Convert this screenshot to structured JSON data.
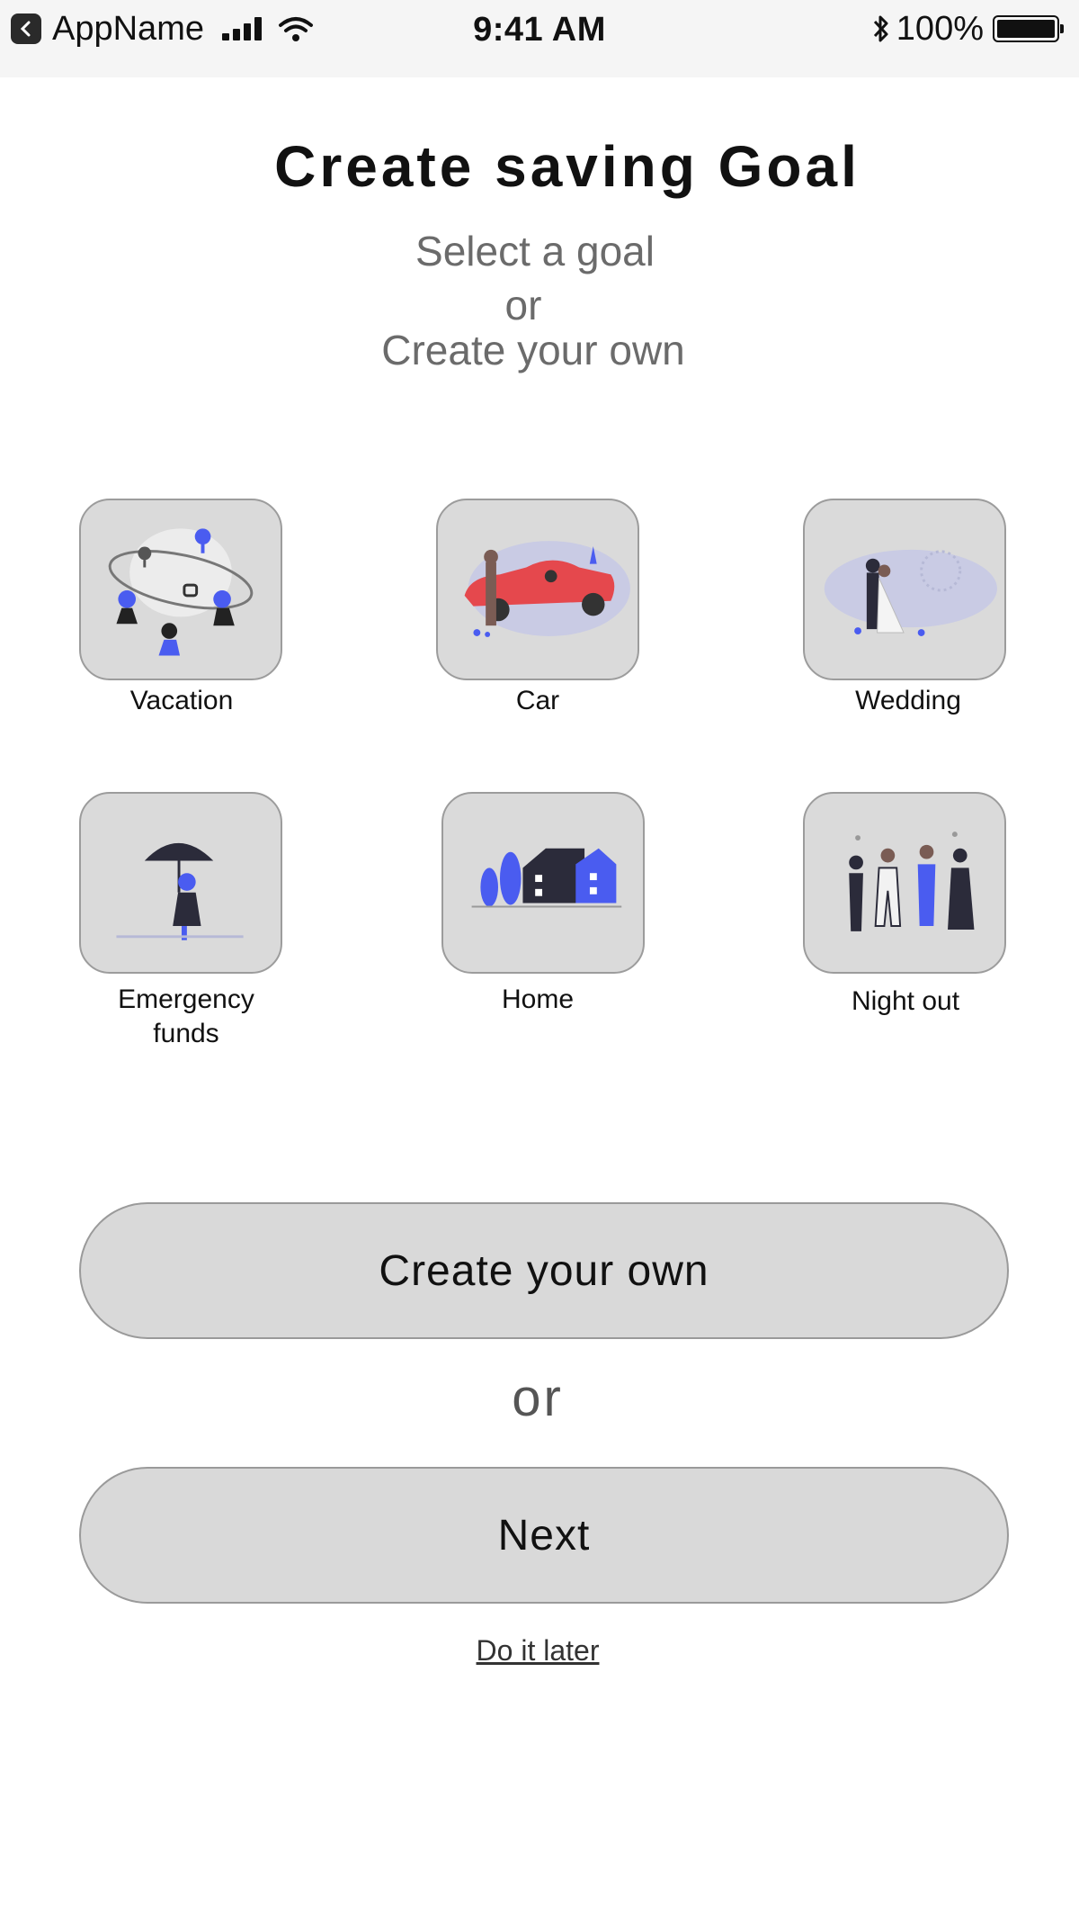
{
  "status_bar": {
    "app_name": "AppName",
    "time": "9:41 AM",
    "battery": "100%",
    "icons": [
      "back-app-icon",
      "signal-icon",
      "wifi-icon",
      "bluetooth-icon",
      "battery-icon"
    ]
  },
  "header": {
    "title": "Create saving Goal",
    "subtitle_line1": "Select a goal",
    "subtitle_line2": "or",
    "subtitle_line3": "Create your own"
  },
  "goals": [
    {
      "label": "Vacation",
      "icon": "vacation-illustration"
    },
    {
      "label": "Car",
      "icon": "car-illustration"
    },
    {
      "label": "Wedding",
      "icon": "wedding-illustration"
    },
    {
      "label": "Emergency\nfunds",
      "icon": "umbrella-illustration"
    },
    {
      "label": "Home",
      "icon": "house-illustration"
    },
    {
      "label": "Night out",
      "icon": "friends-illustration"
    }
  ],
  "actions": {
    "create_own": "Create your own",
    "or": "or",
    "next": "Next",
    "later": "Do it later"
  },
  "colors": {
    "accent": "#4a5cf0",
    "tile_bg": "#dadada",
    "button_bg": "#d9d9d9",
    "text_muted": "#6b6b6b"
  }
}
